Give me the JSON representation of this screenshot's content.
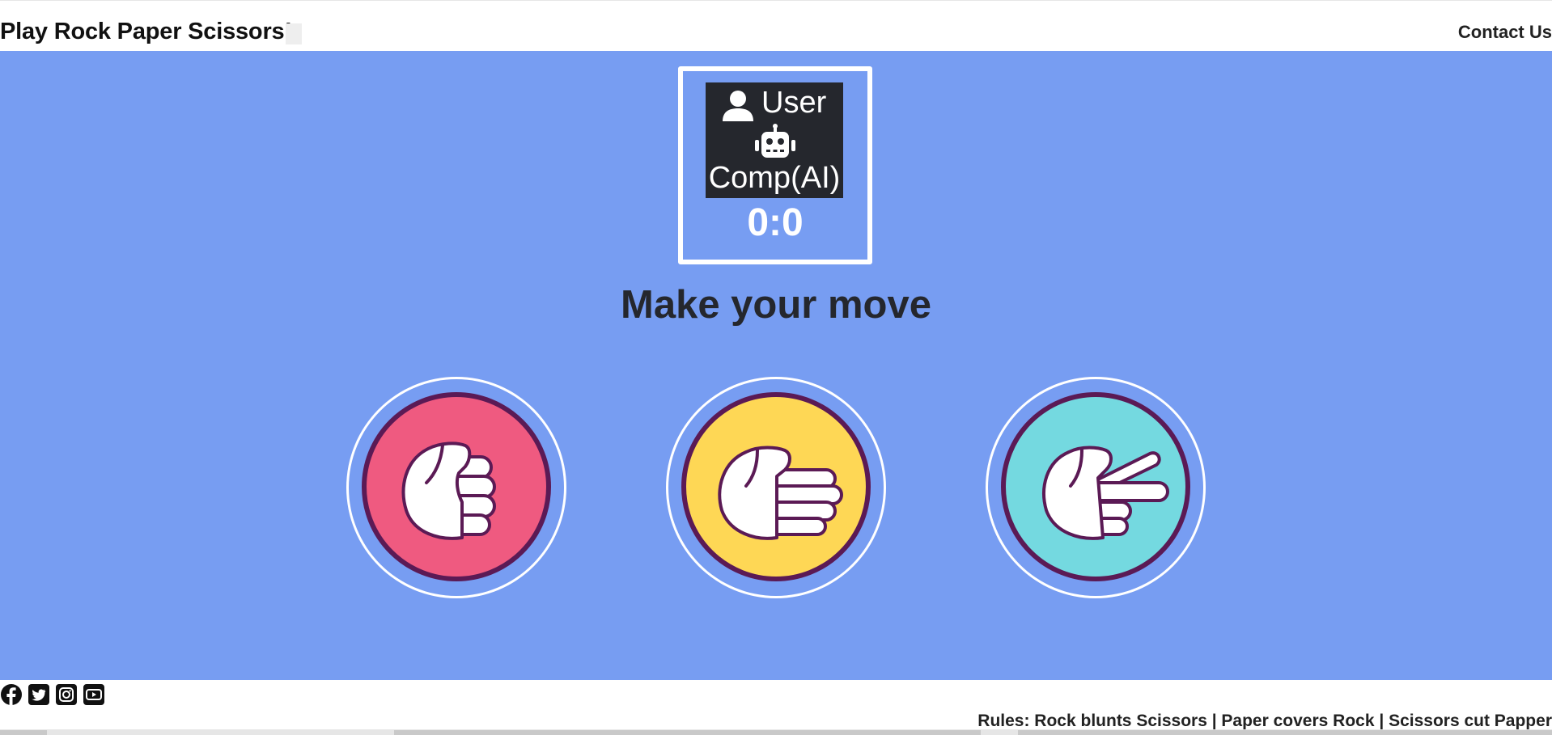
{
  "header": {
    "title": "Play Rock Paper Scissors!",
    "contact_label": "Contact Us"
  },
  "scoreboard": {
    "user_label": "User",
    "comp_label": "Comp(AI)",
    "score": "0:0",
    "user_icon": "user-icon",
    "comp_icon": "robot-icon"
  },
  "game": {
    "prompt": "Make your move",
    "choices": [
      {
        "name": "rock",
        "icon": "fist-hand-icon",
        "color": "#ef5a80"
      },
      {
        "name": "paper",
        "icon": "open-hand-icon",
        "color": "#fed755"
      },
      {
        "name": "scissors",
        "icon": "two-finger-hand-icon",
        "color": "#74d9e0"
      }
    ],
    "ring_color": "#5b1a55",
    "background": "#779df2"
  },
  "footer": {
    "social": [
      "facebook-icon",
      "twitter-icon",
      "instagram-icon",
      "youtube-icon"
    ],
    "rules": "Rules: Rock blunts Scissors | Paper covers Rock | Scissors cut Papper"
  }
}
